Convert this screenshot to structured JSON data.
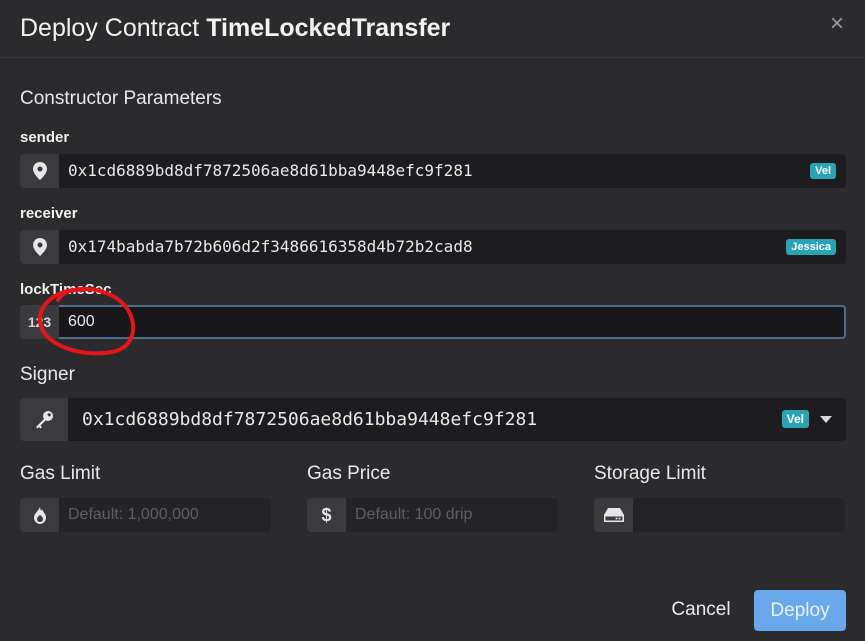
{
  "dialog": {
    "title_prefix": "Deploy Contract",
    "contract_name": "TimeLockedTransfer",
    "close_icon": "×"
  },
  "constructor": {
    "section_title": "Constructor Parameters",
    "sender": {
      "label": "sender",
      "value": "0x1cd6889bd8df7872506ae8d61bba9448efc9f281",
      "badge": "Vel"
    },
    "receiver": {
      "label": "receiver",
      "value": "0x174babda7b72b606d2f3486616358d4b72b2cad8",
      "badge": "Jessica"
    },
    "lockTimeSec": {
      "label": "lockTimeSec",
      "addon": "123",
      "value": "600"
    }
  },
  "signer": {
    "label": "Signer",
    "value": "0x1cd6889bd8df7872506ae8d61bba9448efc9f281",
    "badge": "Vel"
  },
  "gas_limit": {
    "label": "Gas Limit",
    "placeholder": "Default: 1,000,000"
  },
  "gas_price": {
    "label": "Gas Price",
    "placeholder": "Default: 100 drip",
    "addon": "$"
  },
  "storage_limit": {
    "label": "Storage Limit",
    "placeholder": ""
  },
  "footer": {
    "cancel_label": "Cancel",
    "deploy_label": "Deploy"
  },
  "colors": {
    "background": "#2b2b2e",
    "badge": "#2aa3b5",
    "deploy_button": "#6aa8ec",
    "focus_border": "#4f6d8c",
    "annotation": "#e5161b"
  }
}
